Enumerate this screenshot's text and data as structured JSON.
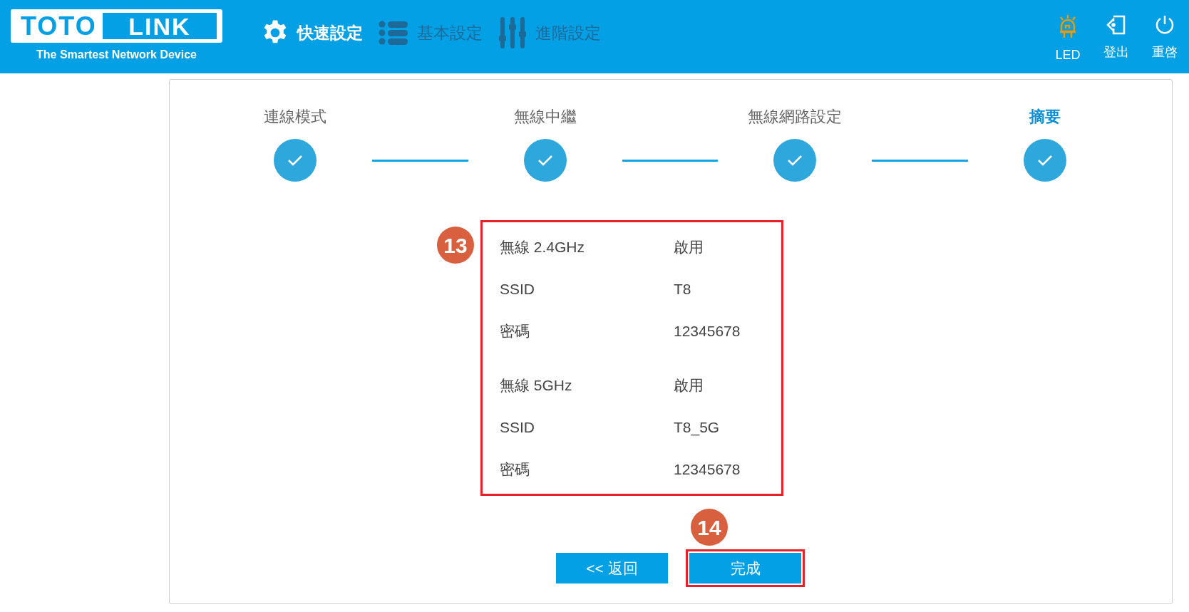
{
  "logo": {
    "left": "TOTO",
    "right": "LINK",
    "tagline": "The Smartest Network Device"
  },
  "nav": [
    {
      "label": "快速設定",
      "kind": "gear",
      "selected": true
    },
    {
      "label": "基本設定",
      "kind": "list",
      "selected": false
    },
    {
      "label": "進階設定",
      "kind": "sliders",
      "selected": false
    }
  ],
  "actions": [
    {
      "label": "LED",
      "kind": "led"
    },
    {
      "label": "登出",
      "kind": "logout"
    },
    {
      "label": "重啓",
      "kind": "power"
    }
  ],
  "steps": [
    {
      "label": "連線模式",
      "done": true,
      "selected": false
    },
    {
      "label": "無線中繼",
      "done": true,
      "selected": false
    },
    {
      "label": "無線網路設定",
      "done": true,
      "selected": false
    },
    {
      "label": "摘要",
      "done": true,
      "selected": true
    }
  ],
  "summary": {
    "callout": "13",
    "groups": [
      {
        "rows": [
          {
            "label": "無線 2.4GHz",
            "value": "啟用"
          },
          {
            "label": "SSID",
            "value": "T8"
          },
          {
            "label": "密碼",
            "value": "12345678"
          }
        ]
      },
      {
        "rows": [
          {
            "label": "無線 5GHz",
            "value": "啟用"
          },
          {
            "label": "SSID",
            "value": "T8_5G"
          },
          {
            "label": "密碼",
            "value": "12345678"
          }
        ]
      }
    ]
  },
  "buttons": [
    {
      "label": "<< 返回",
      "highlighted": false
    },
    {
      "label": "完成",
      "highlighted": true,
      "callout": "14"
    }
  ]
}
